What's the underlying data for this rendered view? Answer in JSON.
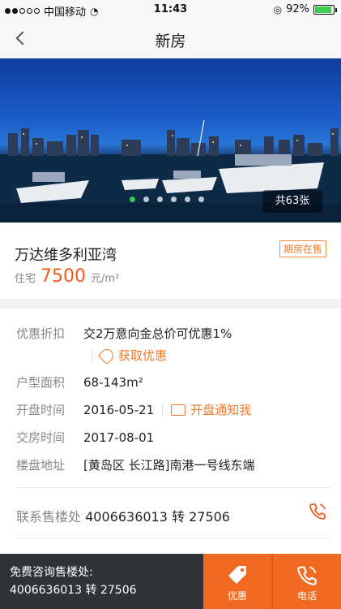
{
  "status": {
    "carrier": "中国移动",
    "time": "11:43",
    "battery": "92%",
    "battery_level": 0.92,
    "signal_bars": 2
  },
  "nav": {
    "title": "新房"
  },
  "gallery": {
    "photo_count": "共63张",
    "dots": 6,
    "active_dot": 0
  },
  "estate": {
    "name": "万达维多利亚湾",
    "badge": "期房在售",
    "price_type": "住宅",
    "price": "7500",
    "price_unit": "元/m²"
  },
  "details": {
    "discount_label": "优惠折扣",
    "discount_value": "交2万意向金总价可优惠1%",
    "get_discount": "获取优惠",
    "area_label": "户型面积",
    "area_value": "68-143m²",
    "open_label": "开盘时间",
    "open_value": "2016-05-21",
    "notify_open": "开盘通知我",
    "delivery_label": "交房时间",
    "delivery_value": "2017-08-01",
    "address_label": "楼盘地址",
    "address_value": "[黄岛区 长江路]南港一号线东端",
    "contact_label": "联系售楼处",
    "contact_value": "4006636013 转 27506"
  },
  "bottom": {
    "consult_line1": "免费咨询售楼处:",
    "consult_line2": "4006636013 转 27506",
    "coupon_label": "优惠",
    "call_label": "电话"
  },
  "colors": {
    "accent": "#f26a21",
    "price": "#f05a1f",
    "bottom_bar": "#2f3439"
  }
}
